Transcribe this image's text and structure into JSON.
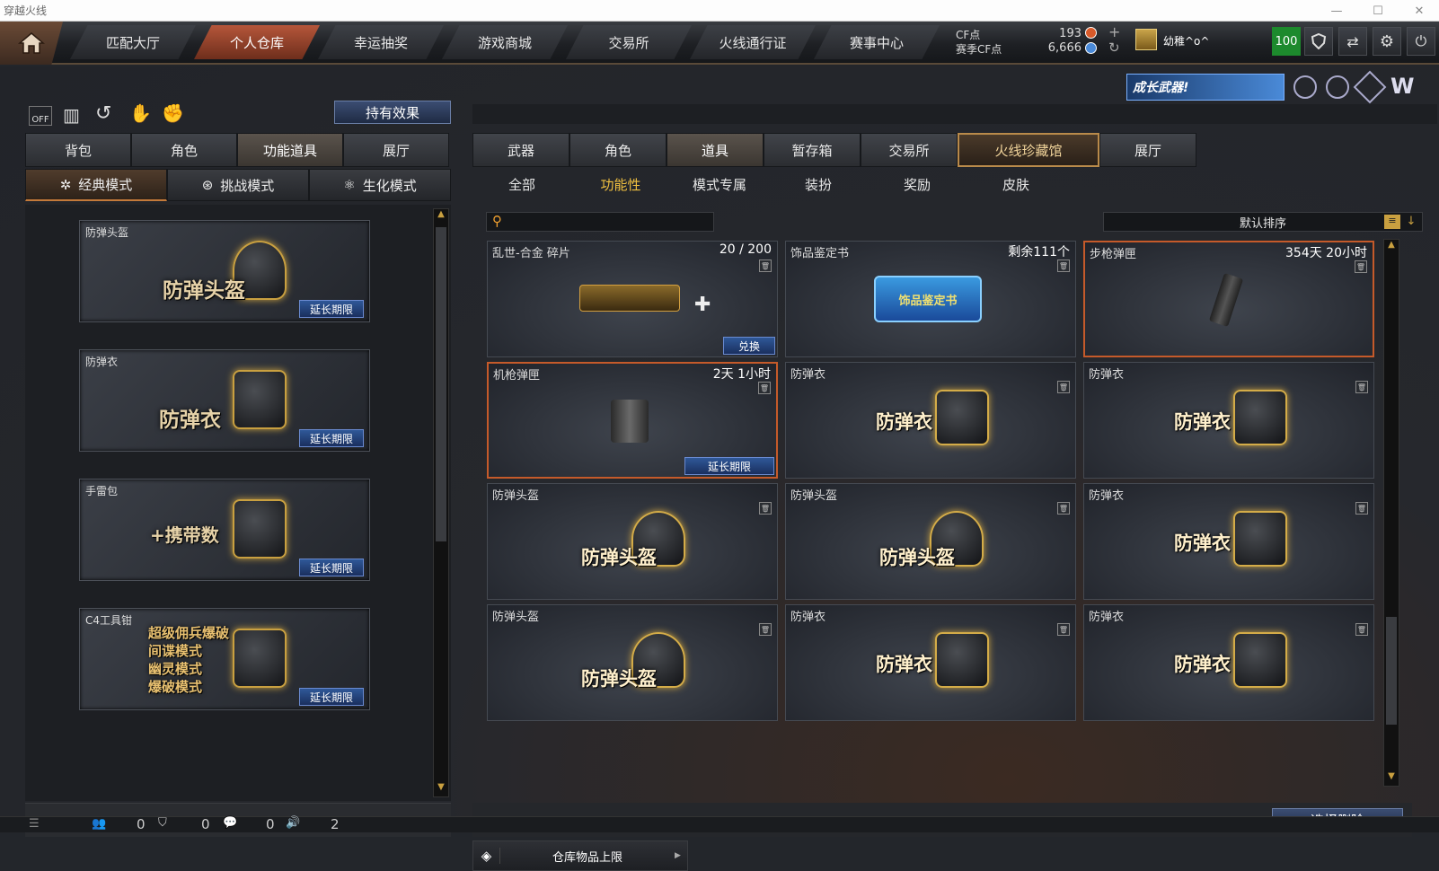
{
  "window": {
    "title": "穿越火线"
  },
  "nav": {
    "tabs": [
      "匹配大厅",
      "个人仓库",
      "幸运抽奖",
      "游戏商城",
      "交易所",
      "火线通行证",
      "赛事中心"
    ],
    "active": 1
  },
  "currency": {
    "cf_label": "CF点",
    "cf_value": "193",
    "season_label": "赛季CF点",
    "season_value": "6,666"
  },
  "user": {
    "name": "幼稚^o^",
    "level": "100"
  },
  "banner": {
    "text": "成长武器!"
  },
  "left": {
    "hold_effect_label": "持有效果",
    "tabs": [
      "背包",
      "角色",
      "功能道具",
      "展厅"
    ],
    "active_tab": 2,
    "modes": [
      "经典模式",
      "挑战模式",
      "生化模式"
    ],
    "active_mode": 0,
    "items": [
      {
        "name": "防弹头盔",
        "big": "防弹头盔",
        "button": "延长期限"
      },
      {
        "name": "防弹衣",
        "big": "防弹衣",
        "button": "延长期限"
      },
      {
        "name": "手雷包",
        "big": "+携带数",
        "button": "延长期限"
      },
      {
        "name": "C4工具钳",
        "lines": [
          "超级佣兵爆破",
          "间谍模式",
          "幽灵模式",
          "爆破模式"
        ],
        "button": "延长期限"
      }
    ]
  },
  "right": {
    "tabs": [
      "武器",
      "角色",
      "道具",
      "暂存箱",
      "交易所",
      "火线珍藏馆",
      "展厅"
    ],
    "active_tab": 2,
    "subtabs": [
      "全部",
      "功能性",
      "模式专属",
      "装扮",
      "奖励",
      "皮肤"
    ],
    "active_subtab": 1,
    "search_placeholder": "",
    "sort_label": "默认排序",
    "grid": [
      {
        "name": "乱世-合金 碎片",
        "right": "20 / 200",
        "button": "兑换",
        "kind": "gun"
      },
      {
        "name": "饰品鉴定书",
        "right": "剩余111个",
        "kind": "book",
        "book_text": "饰品鉴定书"
      },
      {
        "name": "步枪弹匣",
        "right": "354天 20小时",
        "kind": "mag",
        "hl": true
      },
      {
        "name": "机枪弹匣",
        "right": "2天 1小时",
        "button": "延长期限",
        "kind": "mg",
        "hl": true
      },
      {
        "name": "防弹衣",
        "big": "防弹衣",
        "kind": "vest"
      },
      {
        "name": "防弹衣",
        "big": "防弹衣",
        "kind": "vest"
      },
      {
        "name": "防弹头盔",
        "big": "防弹头盔",
        "kind": "helmet"
      },
      {
        "name": "防弹头盔",
        "big": "防弹头盔",
        "kind": "helmet"
      },
      {
        "name": "防弹衣",
        "big": "防弹衣",
        "kind": "vest"
      },
      {
        "name": "防弹头盔",
        "big": "防弹头盔",
        "kind": "helmet"
      },
      {
        "name": "防弹衣",
        "big": "防弹衣",
        "kind": "vest"
      },
      {
        "name": "防弹衣",
        "big": "防弹衣",
        "kind": "vest"
      }
    ],
    "delete_label": "选择删除",
    "storage_label": "仓库物品上限"
  },
  "status": {
    "counts": [
      "0",
      "0",
      "0",
      "2"
    ]
  }
}
